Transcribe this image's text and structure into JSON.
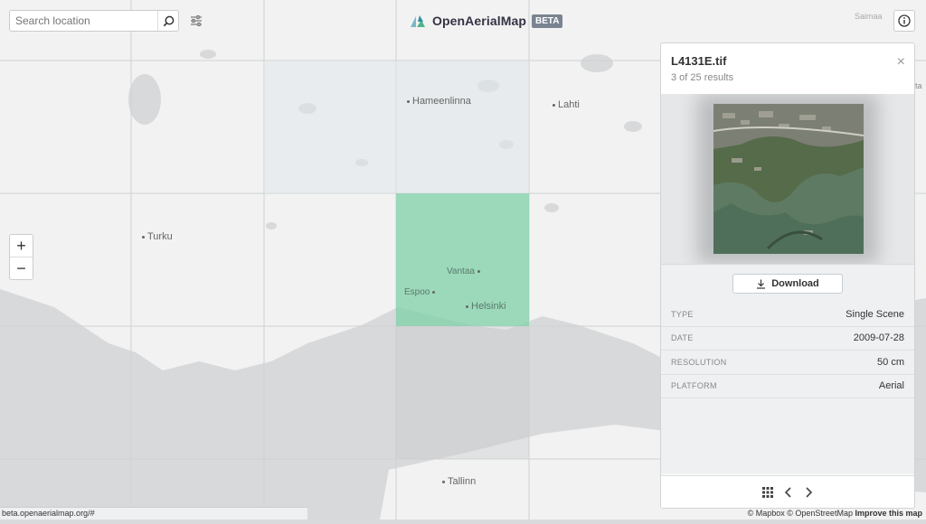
{
  "search": {
    "placeholder": "Search location"
  },
  "brand": {
    "name": "OpenAerialMap",
    "badge": "BETA"
  },
  "map": {
    "cities": [
      "Hameenlinna",
      "Lahti",
      "Turku",
      "Vantaa",
      "Espoo",
      "Helsinki",
      "Tallinn",
      "Saimaa",
      "ta"
    ],
    "highlight_color": "#7fd0a8"
  },
  "zoom": {
    "in": "+",
    "out": "−"
  },
  "panel": {
    "title": "L4131E.tif",
    "subtitle": "3 of 25 results",
    "close": "×",
    "download_label": "Download",
    "rows": [
      {
        "key": "TYPE",
        "value": "Single Scene"
      },
      {
        "key": "DATE",
        "value": "2009-07-28"
      },
      {
        "key": "RESOLUTION",
        "value": "50 cm"
      },
      {
        "key": "PLATFORM",
        "value": "Aerial"
      }
    ]
  },
  "status_url": "beta.openaerialmap.org/#",
  "attribution": {
    "mapbox": "© Mapbox",
    "osm": "© OpenStreetMap",
    "improve": "Improve this map"
  },
  "icons": [
    "search-icon",
    "sliders-icon",
    "info-icon",
    "download-icon",
    "grid-icon",
    "chevron-left-icon",
    "chevron-right-icon",
    "logo-icon"
  ]
}
